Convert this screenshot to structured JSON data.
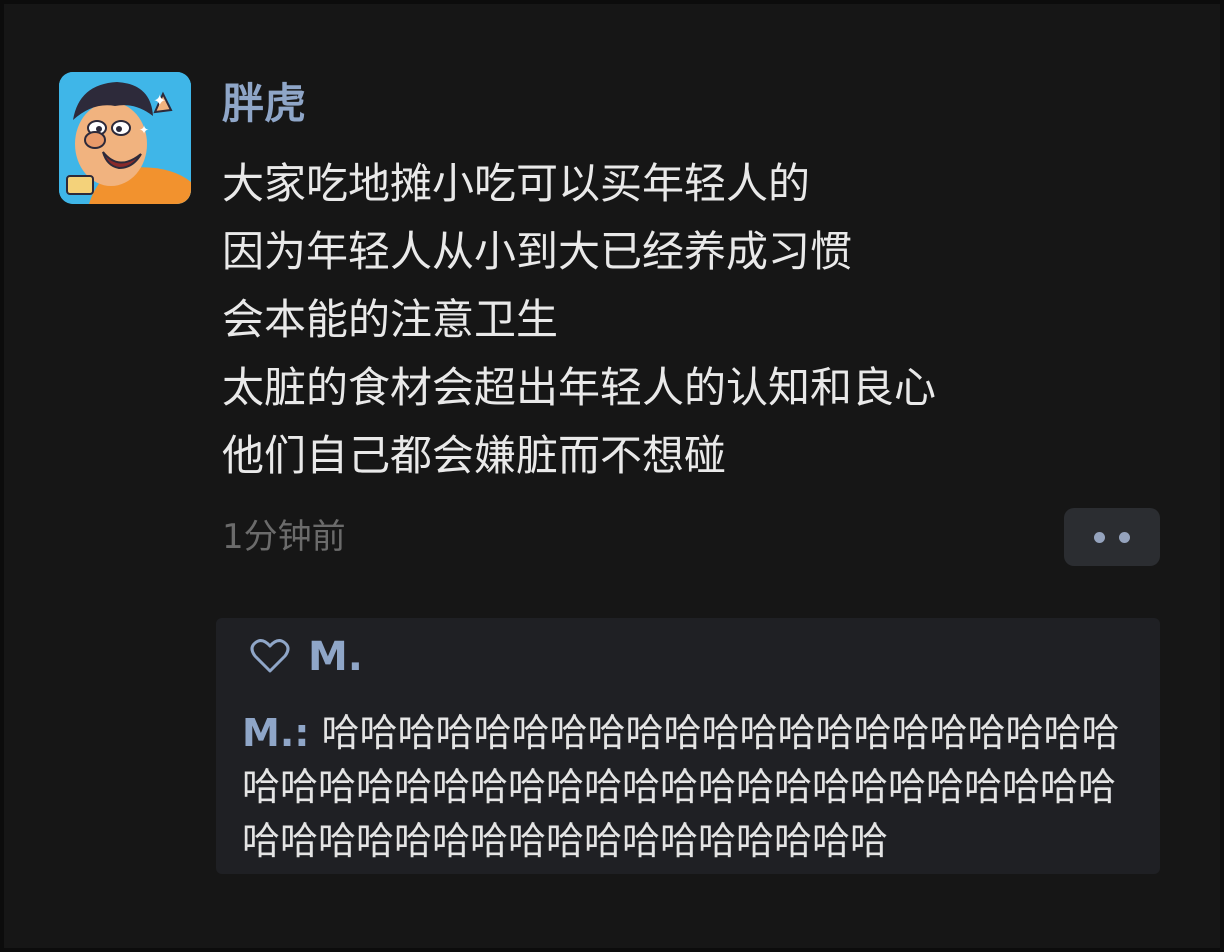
{
  "post": {
    "author": "胖虎",
    "avatar_icon": "cartoon-avatar-icon",
    "lines": [
      "大家吃地摊小吃可以买年轻人的",
      "因为年轻人从小到大已经养成习惯",
      "会本能的注意卫生",
      "太脏的食材会超出年轻人的认知和良心",
      "他们自己都会嫌脏而不想碰"
    ],
    "timestamp": "1分钟前",
    "more_icon": "more-dots-icon"
  },
  "reply": {
    "like_icon": "heart-icon",
    "liked_by": "M.",
    "comment_author": "M.:",
    "comment_text": "哈哈哈哈哈哈哈哈哈哈哈哈哈哈哈哈哈哈哈哈哈哈哈哈哈哈哈哈哈哈哈哈哈哈哈哈哈哈哈哈哈哈哈哈哈哈哈哈哈哈哈哈哈哈哈哈哈哈哈哈哈"
  },
  "colors": {
    "background": "#161616",
    "author": "#8fa6c8",
    "text": "#e9e9e9",
    "muted": "#6b6b6b",
    "panel": "#1f2024"
  }
}
